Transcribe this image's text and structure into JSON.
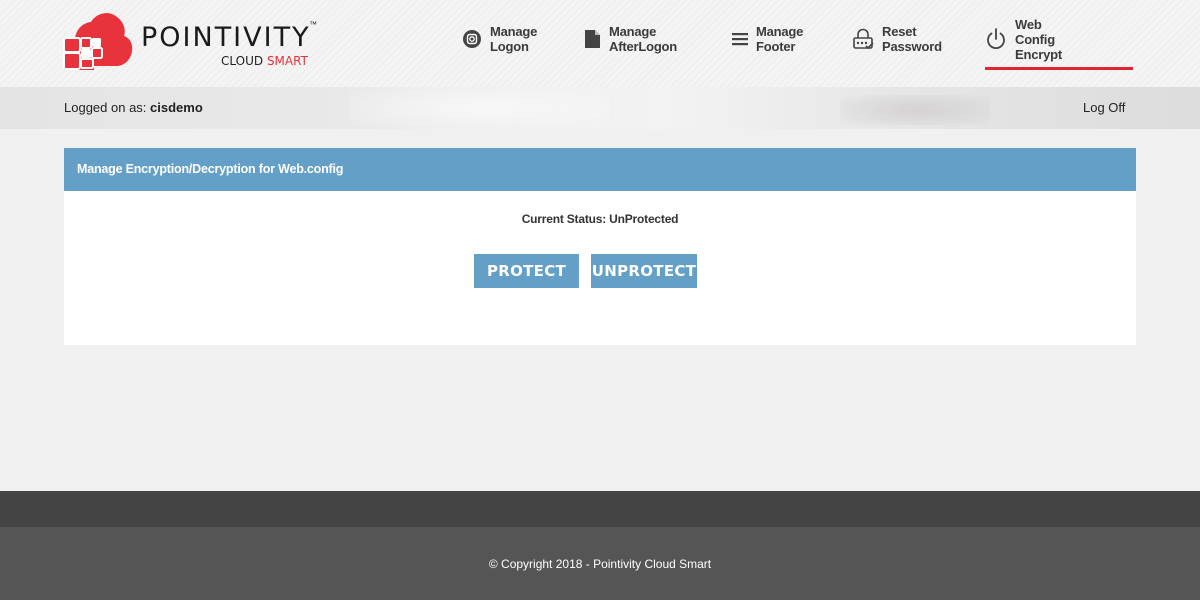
{
  "brand": {
    "name": "POINTIVITY",
    "tm": "™",
    "sub_primary": "CLOUD",
    "sub_accent": "SMART",
    "accent_color": "#e8323c"
  },
  "nav": {
    "items": [
      {
        "label": "Manage Logon",
        "icon": "instagram-icon"
      },
      {
        "label": "Manage AfterLogon",
        "icon": "file-icon"
      },
      {
        "label": "Manage Footer",
        "icon": "menu-icon"
      },
      {
        "label": "Reset Password",
        "icon": "lock-icon"
      },
      {
        "label": "Web Config Encrypt",
        "icon": "power-icon",
        "active": true
      }
    ],
    "active_color": "#e0262e"
  },
  "session": {
    "prefix": "Logged on as:",
    "username": "cisdemo",
    "logoff": "Log Off"
  },
  "panel": {
    "title": "Manage Encryption/Decryption for Web.config",
    "status": "Current Status: UnProtected",
    "protect_label": "PROTECT",
    "unprotect_label": "UNPROTECT",
    "header_color": "#649fc8"
  },
  "footer": {
    "copyright": "© Copyright 2018 - Pointivity Cloud Smart"
  }
}
